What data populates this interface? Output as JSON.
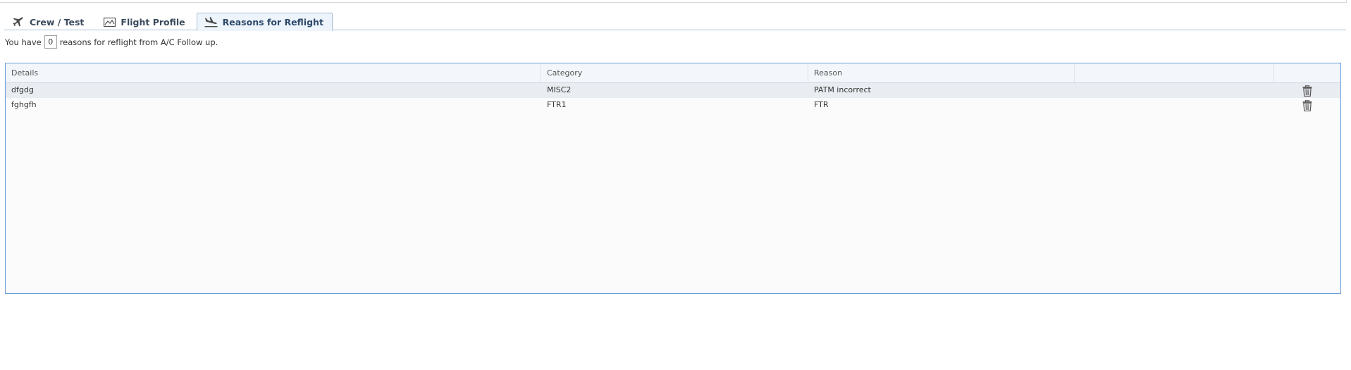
{
  "tabs": [
    {
      "label": "Crew / Test",
      "icon": "airplane-icon",
      "active": false
    },
    {
      "label": "Flight Profile",
      "icon": "image-chart-icon",
      "active": false
    },
    {
      "label": "Reasons for Reflight",
      "icon": "flight-landing-icon",
      "active": true
    }
  ],
  "summary": {
    "prefix": "You have",
    "count": "0",
    "suffix": "reasons for reflight from A/C Follow up."
  },
  "grid": {
    "columns": [
      "Details",
      "Category",
      "Reason",
      "",
      ""
    ],
    "rows": [
      {
        "details": "dfgdg",
        "category": "MISC2",
        "reason": "PATM incorrect",
        "action_icon": "trash-icon"
      },
      {
        "details": "fghgfh",
        "category": "FTR1",
        "reason": "FTR",
        "action_icon": "trash-icon"
      }
    ]
  },
  "colors": {
    "accent_border": "#6a9ed6",
    "tab_active_bg": "#eef4fb",
    "row_selected_bg": "#e9ecf1"
  }
}
